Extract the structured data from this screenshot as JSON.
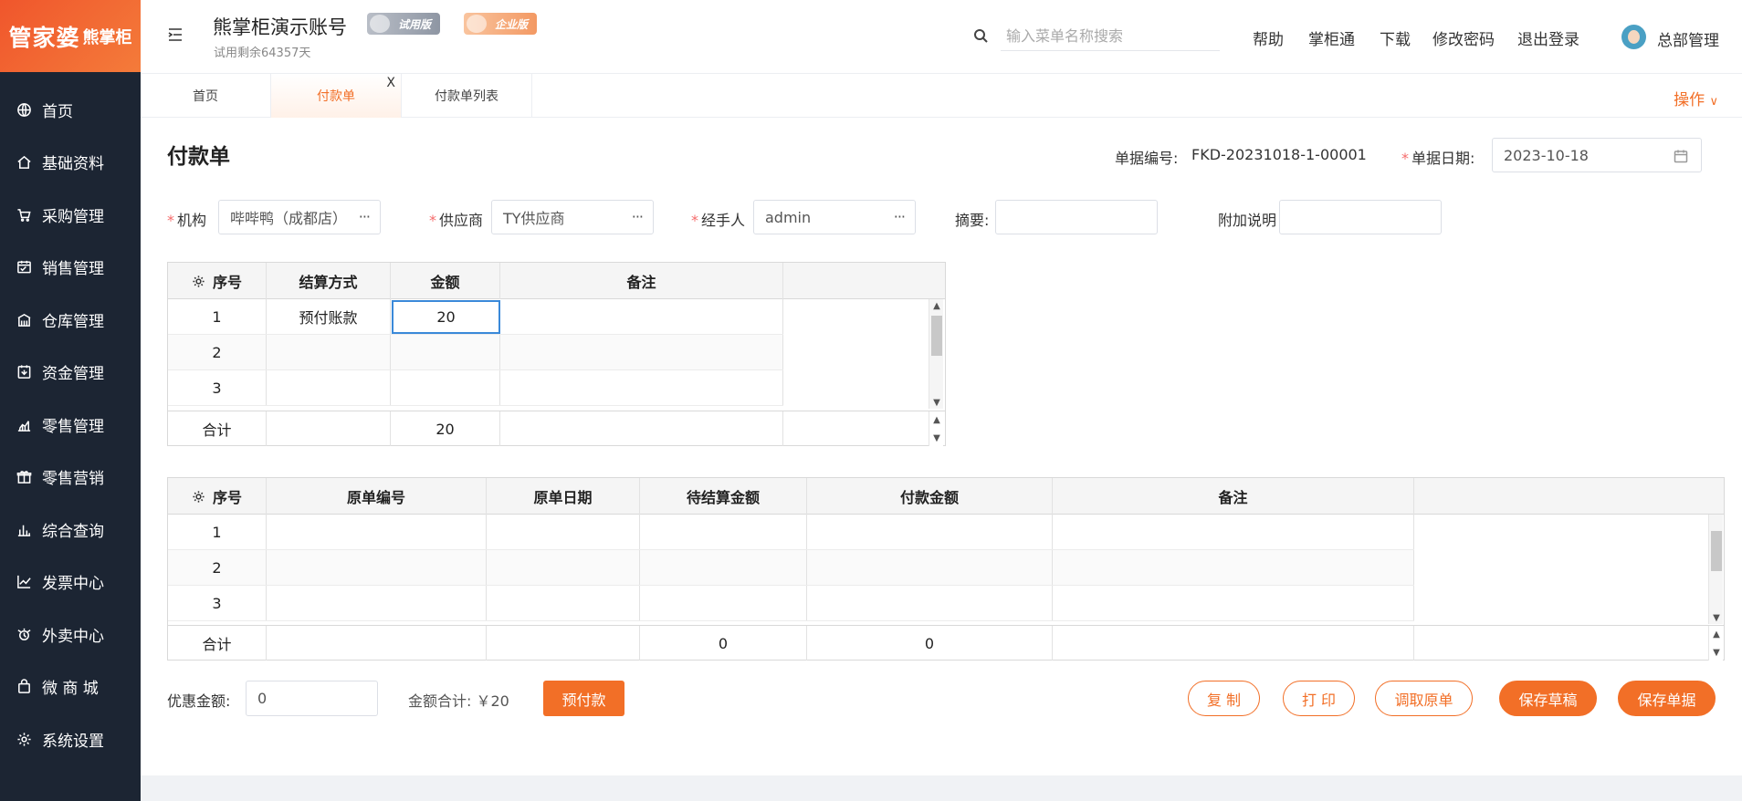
{
  "brand": {
    "logo_main": "管家婆",
    "logo_sub": "熊掌柜"
  },
  "sidebar": {
    "items": [
      {
        "label": "首页",
        "icon": "globe-icon"
      },
      {
        "label": "基础资料",
        "icon": "home-icon"
      },
      {
        "label": "采购管理",
        "icon": "cart-icon"
      },
      {
        "label": "销售管理",
        "icon": "calendar-icon"
      },
      {
        "label": "仓库管理",
        "icon": "warehouse-icon"
      },
      {
        "label": "资金管理",
        "icon": "fund-icon"
      },
      {
        "label": "零售管理",
        "icon": "bar-chart-icon"
      },
      {
        "label": "零售营销",
        "icon": "gift-icon"
      },
      {
        "label": "综合查询",
        "icon": "column-chart-icon"
      },
      {
        "label": "发票中心",
        "icon": "line-chart-icon"
      },
      {
        "label": "外卖中心",
        "icon": "delivery-icon"
      },
      {
        "label": "微 商 城",
        "icon": "shop-bag-icon"
      },
      {
        "label": "系统设置",
        "icon": "gear-icon"
      }
    ]
  },
  "header": {
    "account_title": "熊掌柜演示账号",
    "badge_trial": "试用版",
    "badge_enterprise": "企业版",
    "trial_remaining": "试用剩余64357天",
    "search_placeholder": "输入菜单名称搜索",
    "links": [
      "帮助",
      "掌柜通",
      "下载",
      "修改密码",
      "退出登录"
    ],
    "user_name": "总部管理"
  },
  "tabs": [
    {
      "label": "首页"
    },
    {
      "label": "付款单",
      "active": true,
      "close": "X"
    },
    {
      "label": "付款单列表"
    }
  ],
  "operations_label": "操作",
  "form": {
    "title": "付款单",
    "doc_no_label": "单据编号:",
    "doc_no": "FKD-20231018-1-00001",
    "doc_date_label": "单据日期:",
    "doc_date": "2023-10-18",
    "org_label": "机构",
    "org_value": "哔哔鸭（成都店）",
    "supplier_label": "供应商",
    "supplier_value": "TY供应商",
    "handler_label": "经手人",
    "handler_value": "admin",
    "summary_label": "摘要",
    "summary_value": "",
    "note_label": "附加说明",
    "note_value": "",
    "required_mark": "*",
    "more_dots": "···"
  },
  "settle_grid": {
    "headers": [
      "序号",
      "结算方式",
      "金额",
      "备注"
    ],
    "rows": [
      {
        "no": "1",
        "method": "预付账款",
        "amount": "20",
        "remark": ""
      },
      {
        "no": "2",
        "method": "",
        "amount": "",
        "remark": ""
      },
      {
        "no": "3",
        "method": "",
        "amount": "",
        "remark": ""
      }
    ],
    "total_label": "合计",
    "total_amount": "20"
  },
  "source_grid": {
    "headers": [
      "序号",
      "原单编号",
      "原单日期",
      "待结算金额",
      "付款金额",
      "备注"
    ],
    "rows": [
      {
        "no": "1"
      },
      {
        "no": "2"
      },
      {
        "no": "3"
      }
    ],
    "total_label": "合计",
    "total_pending": "0",
    "total_payment": "0"
  },
  "footer": {
    "discount_label": "优惠金额:",
    "discount_value": "0",
    "sum_label": "金额合计: ￥20",
    "prepay_button": "预付款",
    "copy_button": "复 制",
    "print_button": "打 印",
    "fetch_button": "调取原单",
    "save_draft_button": "保存草稿",
    "save_button": "保存单据"
  },
  "colors": {
    "accent": "#f26f27",
    "sidebar_bg": "#1c2533",
    "required": "#f56c6c"
  }
}
